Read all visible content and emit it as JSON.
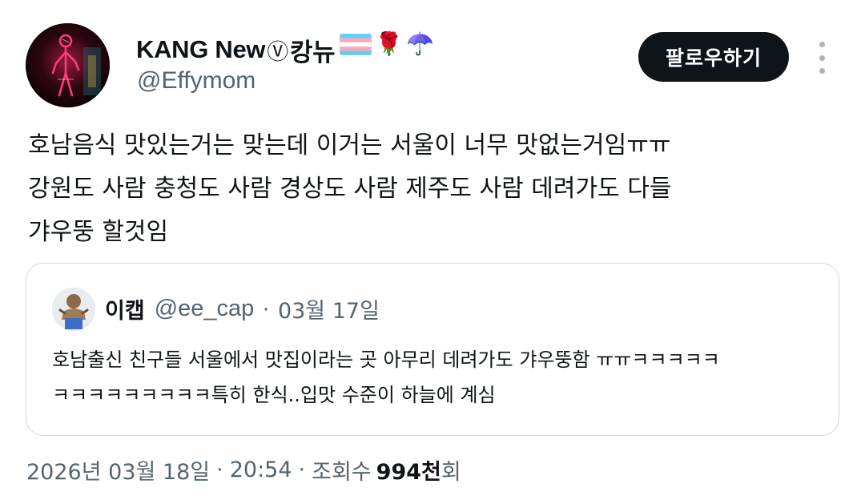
{
  "author": {
    "display_name": "KANG New",
    "name_mark": "Ⓥ",
    "name_suffix": " 캉뉴",
    "emojis": [
      "rose-emoji",
      "umbrella-emoji"
    ],
    "emoji_rose": "🌹",
    "emoji_umbrella": "☂️",
    "flag": "transgender-flag",
    "handle": "@Effymom"
  },
  "follow_button_label": "팔로우하기",
  "more_button": "more-options-icon",
  "tweet_lines": [
    "호남음식 맛있는거는 맞는데 이거는 서울이 너무 맛없는거임ㅠㅠ",
    "강원도 사람 충청도 사람 경상도 사람 제주도 사람 데려가도 다들",
    "갸우뚱 할것임"
  ],
  "quote": {
    "name": "이캡",
    "handle": "@ee_cap",
    "separator": "·",
    "date": "03월 17일",
    "lines": [
      "호남출신 친구들 서울에서 맛집이라는 곳 아무리 데려가도 갸우뚱함 ㅠㅠㅋㅋㅋㅋㅋ",
      "ㅋㅋㅋㅋㅋㅋㅋㅋㅋ특히 한식..입맛 수준이 하늘에 계심"
    ]
  },
  "meta": {
    "date": "2026년 03월 18일",
    "separator": "·",
    "time": "20:54",
    "views_prefix": "조회수",
    "views_count": "994천",
    "views_suffix": "회"
  },
  "colors": {
    "text_primary": "#0f1419",
    "text_secondary": "#536471",
    "border": "#cfd9de",
    "button_bg": "#0f1419",
    "button_text": "#ffffff"
  }
}
